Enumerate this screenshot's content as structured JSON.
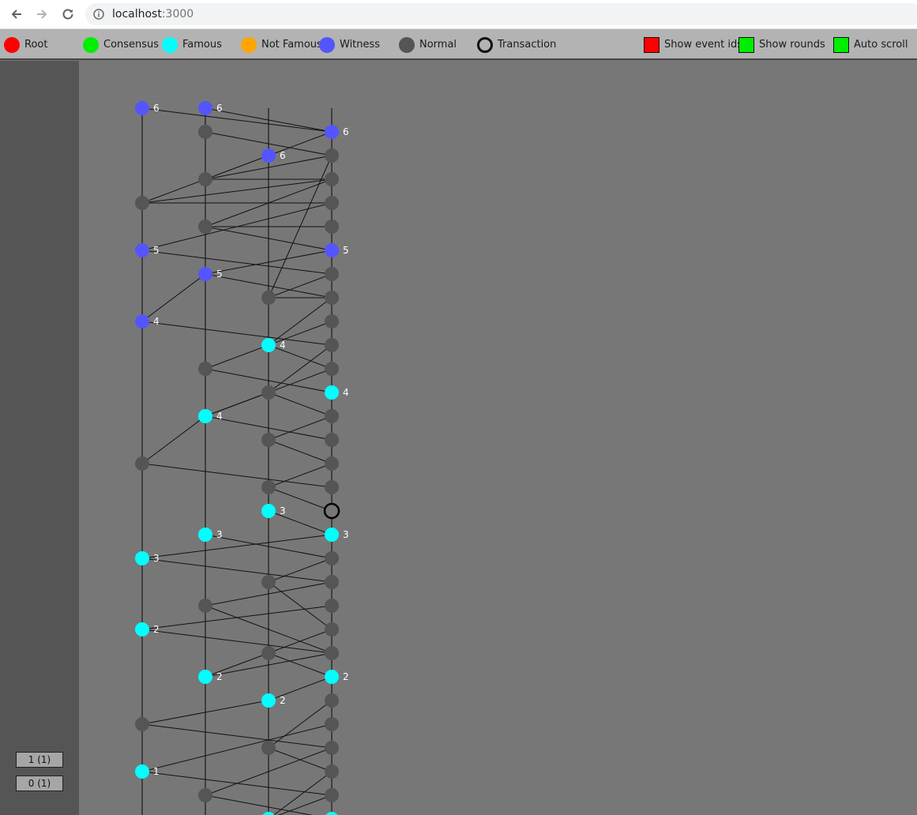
{
  "browser": {
    "url_host": "localhost",
    "url_port": ":3000"
  },
  "legend": {
    "items": [
      {
        "label": "Root",
        "color": "#ff0000",
        "icon": "root-dot-icon"
      },
      {
        "label": "Consensus",
        "color": "#00ee00",
        "icon": "consensus-dot-icon"
      },
      {
        "label": "Famous",
        "color": "#00ffff",
        "icon": "famous-dot-icon"
      },
      {
        "label": "Not Famous",
        "color": "#ffa500",
        "icon": "not-famous-dot-icon"
      },
      {
        "label": "Witness",
        "color": "#5555ff",
        "icon": "witness-dot-icon"
      },
      {
        "label": "Normal",
        "color": "#555555",
        "icon": "normal-dot-icon"
      },
      {
        "label": "Transaction",
        "color": "outline",
        "icon": "transaction-ring-icon"
      }
    ],
    "toggles": [
      {
        "label": "Show event ids",
        "color": "#ff0000",
        "on": false
      },
      {
        "label": "Show rounds",
        "color": "#00ee00",
        "on": true
      },
      {
        "label": "Auto scroll",
        "color": "#00ee00",
        "on": true
      }
    ]
  },
  "sidebar": {
    "buttons": [
      "1 (1)",
      "0 (1)"
    ]
  },
  "graph": {
    "colors": {
      "witness": "#5555ff",
      "famous": "#00ffff",
      "normal": "#555555"
    },
    "columns": [
      "A",
      "B",
      "C",
      "D"
    ],
    "events": [
      {
        "id": "a6",
        "col": "A",
        "row": 0,
        "type": "witness",
        "round": "6"
      },
      {
        "id": "b6",
        "col": "B",
        "row": 0,
        "type": "witness",
        "round": "6"
      },
      {
        "id": "d6",
        "col": "D",
        "row": 1,
        "type": "witness",
        "round": "6"
      },
      {
        "id": "b_1",
        "col": "B",
        "row": 1,
        "type": "normal"
      },
      {
        "id": "c6",
        "col": "C",
        "row": 2,
        "type": "witness",
        "round": "6"
      },
      {
        "id": "d_2",
        "col": "D",
        "row": 2,
        "type": "normal"
      },
      {
        "id": "b_3",
        "col": "B",
        "row": 3,
        "type": "normal"
      },
      {
        "id": "d_3",
        "col": "D",
        "row": 3,
        "type": "normal"
      },
      {
        "id": "a_4",
        "col": "A",
        "row": 4,
        "type": "normal"
      },
      {
        "id": "d_4",
        "col": "D",
        "row": 4,
        "type": "normal"
      },
      {
        "id": "b_5",
        "col": "B",
        "row": 5,
        "type": "normal"
      },
      {
        "id": "d_5",
        "col": "D",
        "row": 5,
        "type": "normal"
      },
      {
        "id": "a5",
        "col": "A",
        "row": 6,
        "type": "witness",
        "round": "5"
      },
      {
        "id": "d5",
        "col": "D",
        "row": 6,
        "type": "witness",
        "round": "5"
      },
      {
        "id": "b5",
        "col": "B",
        "row": 7,
        "type": "witness",
        "round": "5"
      },
      {
        "id": "d_7",
        "col": "D",
        "row": 7,
        "type": "normal"
      },
      {
        "id": "c_8",
        "col": "C",
        "row": 8,
        "type": "normal"
      },
      {
        "id": "d_8",
        "col": "D",
        "row": 8,
        "type": "normal"
      },
      {
        "id": "a4",
        "col": "A",
        "row": 9,
        "type": "witness",
        "round": "4"
      },
      {
        "id": "d_9",
        "col": "D",
        "row": 9,
        "type": "normal"
      },
      {
        "id": "c4",
        "col": "C",
        "row": 10,
        "type": "famous",
        "round": "4"
      },
      {
        "id": "d_10",
        "col": "D",
        "row": 10,
        "type": "normal"
      },
      {
        "id": "b_11",
        "col": "B",
        "row": 11,
        "type": "normal"
      },
      {
        "id": "d_11",
        "col": "D",
        "row": 11,
        "type": "normal"
      },
      {
        "id": "c_12",
        "col": "C",
        "row": 12,
        "type": "normal"
      },
      {
        "id": "d4",
        "col": "D",
        "row": 12,
        "type": "famous",
        "round": "4"
      },
      {
        "id": "b4",
        "col": "B",
        "row": 13,
        "type": "famous",
        "round": "4"
      },
      {
        "id": "d_13",
        "col": "D",
        "row": 13,
        "type": "normal"
      },
      {
        "id": "c_14",
        "col": "C",
        "row": 14,
        "type": "normal"
      },
      {
        "id": "d_14",
        "col": "D",
        "row": 14,
        "type": "normal"
      },
      {
        "id": "a_15",
        "col": "A",
        "row": 15,
        "type": "normal"
      },
      {
        "id": "d_15",
        "col": "D",
        "row": 15,
        "type": "normal"
      },
      {
        "id": "c_16",
        "col": "C",
        "row": 16,
        "type": "normal"
      },
      {
        "id": "d_16",
        "col": "D",
        "row": 16,
        "type": "normal"
      },
      {
        "id": "c3",
        "col": "C",
        "row": 17,
        "type": "famous",
        "round": "3"
      },
      {
        "id": "d_tx",
        "col": "D",
        "row": 17,
        "type": "transaction"
      },
      {
        "id": "b3",
        "col": "B",
        "row": 18,
        "type": "famous",
        "round": "3"
      },
      {
        "id": "d3",
        "col": "D",
        "row": 18,
        "type": "famous",
        "round": "3"
      },
      {
        "id": "a3",
        "col": "A",
        "row": 19,
        "type": "famous",
        "round": "3"
      },
      {
        "id": "d_19",
        "col": "D",
        "row": 19,
        "type": "normal"
      },
      {
        "id": "c_20",
        "col": "C",
        "row": 20,
        "type": "normal"
      },
      {
        "id": "d_20",
        "col": "D",
        "row": 20,
        "type": "normal"
      },
      {
        "id": "b_21",
        "col": "B",
        "row": 21,
        "type": "normal"
      },
      {
        "id": "d_21",
        "col": "D",
        "row": 21,
        "type": "normal"
      },
      {
        "id": "a2",
        "col": "A",
        "row": 22,
        "type": "famous",
        "round": "2"
      },
      {
        "id": "d_22",
        "col": "D",
        "row": 22,
        "type": "normal"
      },
      {
        "id": "c_23",
        "col": "C",
        "row": 23,
        "type": "normal"
      },
      {
        "id": "d_23",
        "col": "D",
        "row": 23,
        "type": "normal"
      },
      {
        "id": "b2",
        "col": "B",
        "row": 24,
        "type": "famous",
        "round": "2"
      },
      {
        "id": "d2",
        "col": "D",
        "row": 24,
        "type": "famous",
        "round": "2"
      },
      {
        "id": "c2",
        "col": "C",
        "row": 25,
        "type": "famous",
        "round": "2"
      },
      {
        "id": "d_25",
        "col": "D",
        "row": 25,
        "type": "normal"
      },
      {
        "id": "a_26",
        "col": "A",
        "row": 26,
        "type": "normal"
      },
      {
        "id": "d_26",
        "col": "D",
        "row": 26,
        "type": "normal"
      },
      {
        "id": "c_27",
        "col": "C",
        "row": 27,
        "type": "normal"
      },
      {
        "id": "d_27",
        "col": "D",
        "row": 27,
        "type": "normal"
      },
      {
        "id": "a1",
        "col": "A",
        "row": 28,
        "type": "famous",
        "round": "1"
      },
      {
        "id": "d_28",
        "col": "D",
        "row": 28,
        "type": "normal"
      },
      {
        "id": "b_29",
        "col": "B",
        "row": 29,
        "type": "normal"
      },
      {
        "id": "d_29",
        "col": "D",
        "row": 29,
        "type": "normal"
      },
      {
        "id": "c_30",
        "col": "C",
        "row": 30,
        "type": "famous"
      },
      {
        "id": "d_30",
        "col": "D",
        "row": 30,
        "type": "famous"
      }
    ],
    "edges": [
      [
        "a6",
        "d6"
      ],
      [
        "b6",
        "d6"
      ],
      [
        "b_1",
        "d_2"
      ],
      [
        "d6",
        "c6"
      ],
      [
        "c6",
        "b_3"
      ],
      [
        "d_2",
        "b_3"
      ],
      [
        "b_3",
        "a_4"
      ],
      [
        "b_3",
        "d_3"
      ],
      [
        "d_3",
        "a_4"
      ],
      [
        "a_4",
        "d_4"
      ],
      [
        "d_3",
        "b_5"
      ],
      [
        "b_5",
        "d_5"
      ],
      [
        "d_4",
        "a5"
      ],
      [
        "b_5",
        "d5"
      ],
      [
        "a5",
        "d_7"
      ],
      [
        "d5",
        "b5"
      ],
      [
        "b5",
        "d_8"
      ],
      [
        "d_2",
        "c_8"
      ],
      [
        "c_8",
        "d_8"
      ],
      [
        "d_7",
        "c_8"
      ],
      [
        "b5",
        "a4"
      ],
      [
        "a4",
        "d_10"
      ],
      [
        "d_8",
        "c4"
      ],
      [
        "c4",
        "d_11"
      ],
      [
        "d_9",
        "b_11"
      ],
      [
        "b_11",
        "d4"
      ],
      [
        "c_12",
        "d_13"
      ],
      [
        "d_10",
        "c_12"
      ],
      [
        "d_11",
        "b4"
      ],
      [
        "c_12",
        "b4"
      ],
      [
        "b4",
        "d_14"
      ],
      [
        "d_13",
        "c_14"
      ],
      [
        "c_14",
        "d_15"
      ],
      [
        "a_15",
        "b4"
      ],
      [
        "a_15",
        "d_16"
      ],
      [
        "d_15",
        "c_16"
      ],
      [
        "c_16",
        "d_tx"
      ],
      [
        "c3",
        "d3"
      ],
      [
        "d3",
        "a3"
      ],
      [
        "a3",
        "d_20"
      ],
      [
        "b3",
        "d_19"
      ],
      [
        "d_19",
        "c_20"
      ],
      [
        "c_20",
        "d_22"
      ],
      [
        "d_20",
        "b_21"
      ],
      [
        "b_21",
        "d_23"
      ],
      [
        "d_21",
        "a2"
      ],
      [
        "a2",
        "d_23"
      ],
      [
        "d_22",
        "c_23"
      ],
      [
        "c_23",
        "d2"
      ],
      [
        "d_23",
        "b2"
      ],
      [
        "b2",
        "c_23"
      ],
      [
        "d_24",
        "c2"
      ],
      [
        "d2",
        "c2"
      ],
      [
        "c2",
        "a_26"
      ],
      [
        "a_26",
        "d_27"
      ],
      [
        "d_25",
        "c_27"
      ],
      [
        "c_27",
        "d_28"
      ],
      [
        "d_26",
        "a1"
      ],
      [
        "a1",
        "d_29"
      ],
      [
        "d_27",
        "b_29"
      ],
      [
        "d_28",
        "c_30"
      ],
      [
        "b_29",
        "d_30"
      ],
      [
        "d_29",
        "c_30"
      ]
    ]
  }
}
